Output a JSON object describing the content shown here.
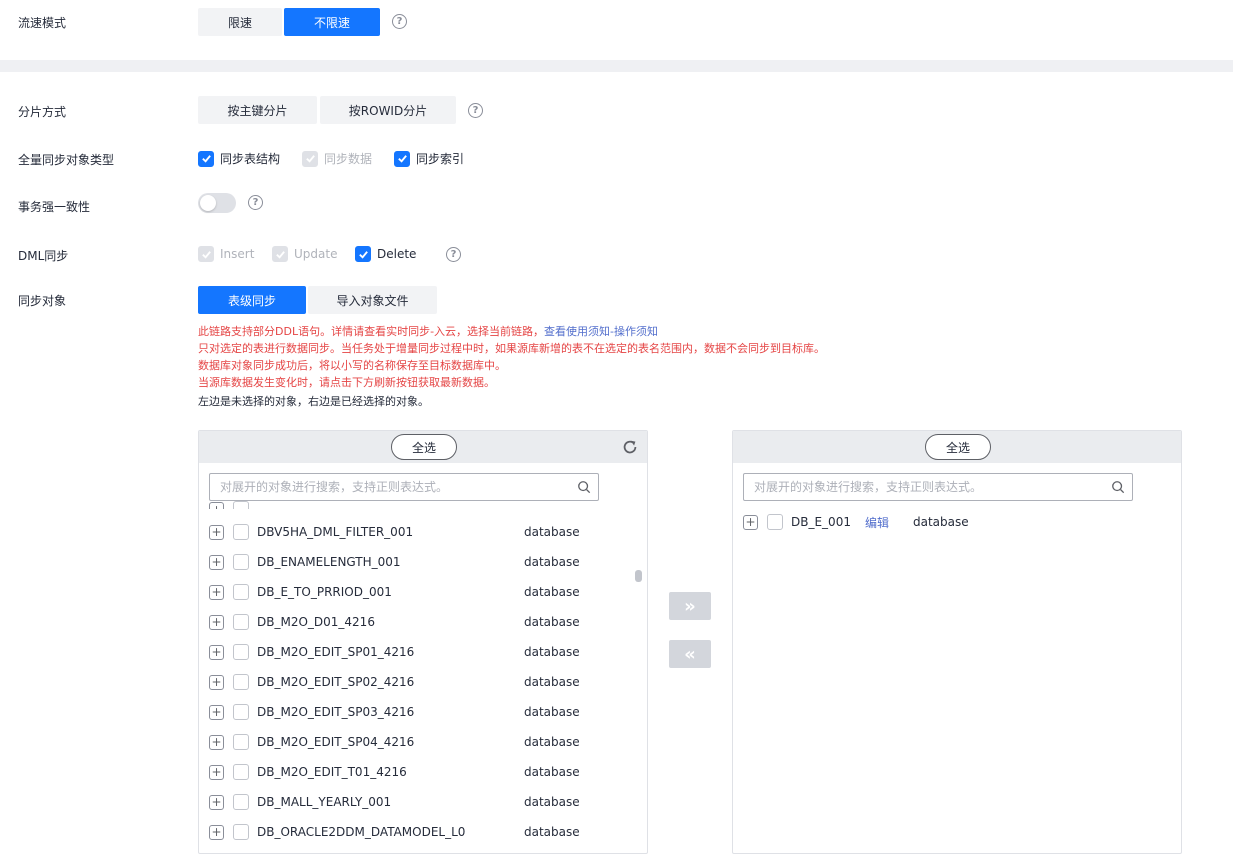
{
  "flow_mode": {
    "label": "流速模式",
    "options": [
      "限速",
      "不限速"
    ],
    "selected": "不限速"
  },
  "shard_mode": {
    "label": "分片方式",
    "options": [
      "按主键分片",
      "按ROWID分片"
    ]
  },
  "full_sync_types": {
    "label": "全量同步对象类型",
    "items": [
      {
        "label": "同步表结构",
        "checked": true,
        "disabled": false
      },
      {
        "label": "同步数据",
        "checked": true,
        "disabled": true
      },
      {
        "label": "同步索引",
        "checked": true,
        "disabled": false
      }
    ]
  },
  "txn_consistency": {
    "label": "事务强一致性",
    "enabled": false
  },
  "dml_sync": {
    "label": "DML同步",
    "items": [
      {
        "label": "Insert",
        "checked": true,
        "disabled": true
      },
      {
        "label": "Update",
        "checked": true,
        "disabled": true
      },
      {
        "label": "Delete",
        "checked": true,
        "disabled": false
      }
    ]
  },
  "sync_objects": {
    "label": "同步对象",
    "tabs": [
      "表级同步",
      "导入对象文件"
    ],
    "active_tab": "表级同步",
    "notes": {
      "line1_prefix": "此链路支持部分DDL语句。详情请查看实时同步-入云，选择当前链路，",
      "line1_link": "查看使用须知-操作须知",
      "line2": "只对选定的表进行数据同步。当任务处于增量同步过程中时，如果源库新增的表不在选定的表名范围内，数据不会同步到目标库。",
      "line3": "数据库对象同步成功后，将以小写的名称保存至目标数据库中。",
      "line4": "当源库数据发生变化时，请点击下方刷新按钮获取最新数据。",
      "line5": "左边是未选择的对象，右边是已经选择的对象。"
    }
  },
  "left_panel": {
    "select_all": "全选",
    "search_placeholder": "对展开的对象进行搜索，支持正则表达式。",
    "rows": [
      {
        "name": "DBV5HA_DML_FILTER_001",
        "type": "database"
      },
      {
        "name": "DB_ENAMELENGTH_001",
        "type": "database"
      },
      {
        "name": "DB_E_TO_PRRIOD_001",
        "type": "database"
      },
      {
        "name": "DB_M2O_D01_4216",
        "type": "database"
      },
      {
        "name": "DB_M2O_EDIT_SP01_4216",
        "type": "database"
      },
      {
        "name": "DB_M2O_EDIT_SP02_4216",
        "type": "database"
      },
      {
        "name": "DB_M2O_EDIT_SP03_4216",
        "type": "database"
      },
      {
        "name": "DB_M2O_EDIT_SP04_4216",
        "type": "database"
      },
      {
        "name": "DB_M2O_EDIT_T01_4216",
        "type": "database"
      },
      {
        "name": "DB_MALL_YEARLY_001",
        "type": "database"
      },
      {
        "name": "DB_ORACLE2DDM_DATAMODEL_L0",
        "type": "database"
      }
    ]
  },
  "right_panel": {
    "select_all": "全选",
    "search_placeholder": "对展开的对象进行搜索，支持正则表达式。",
    "rows": [
      {
        "name": "DB_E_001",
        "edit": "编辑",
        "type": "database"
      }
    ]
  },
  "transfer": {
    "to_right": "»",
    "to_left": "«"
  }
}
